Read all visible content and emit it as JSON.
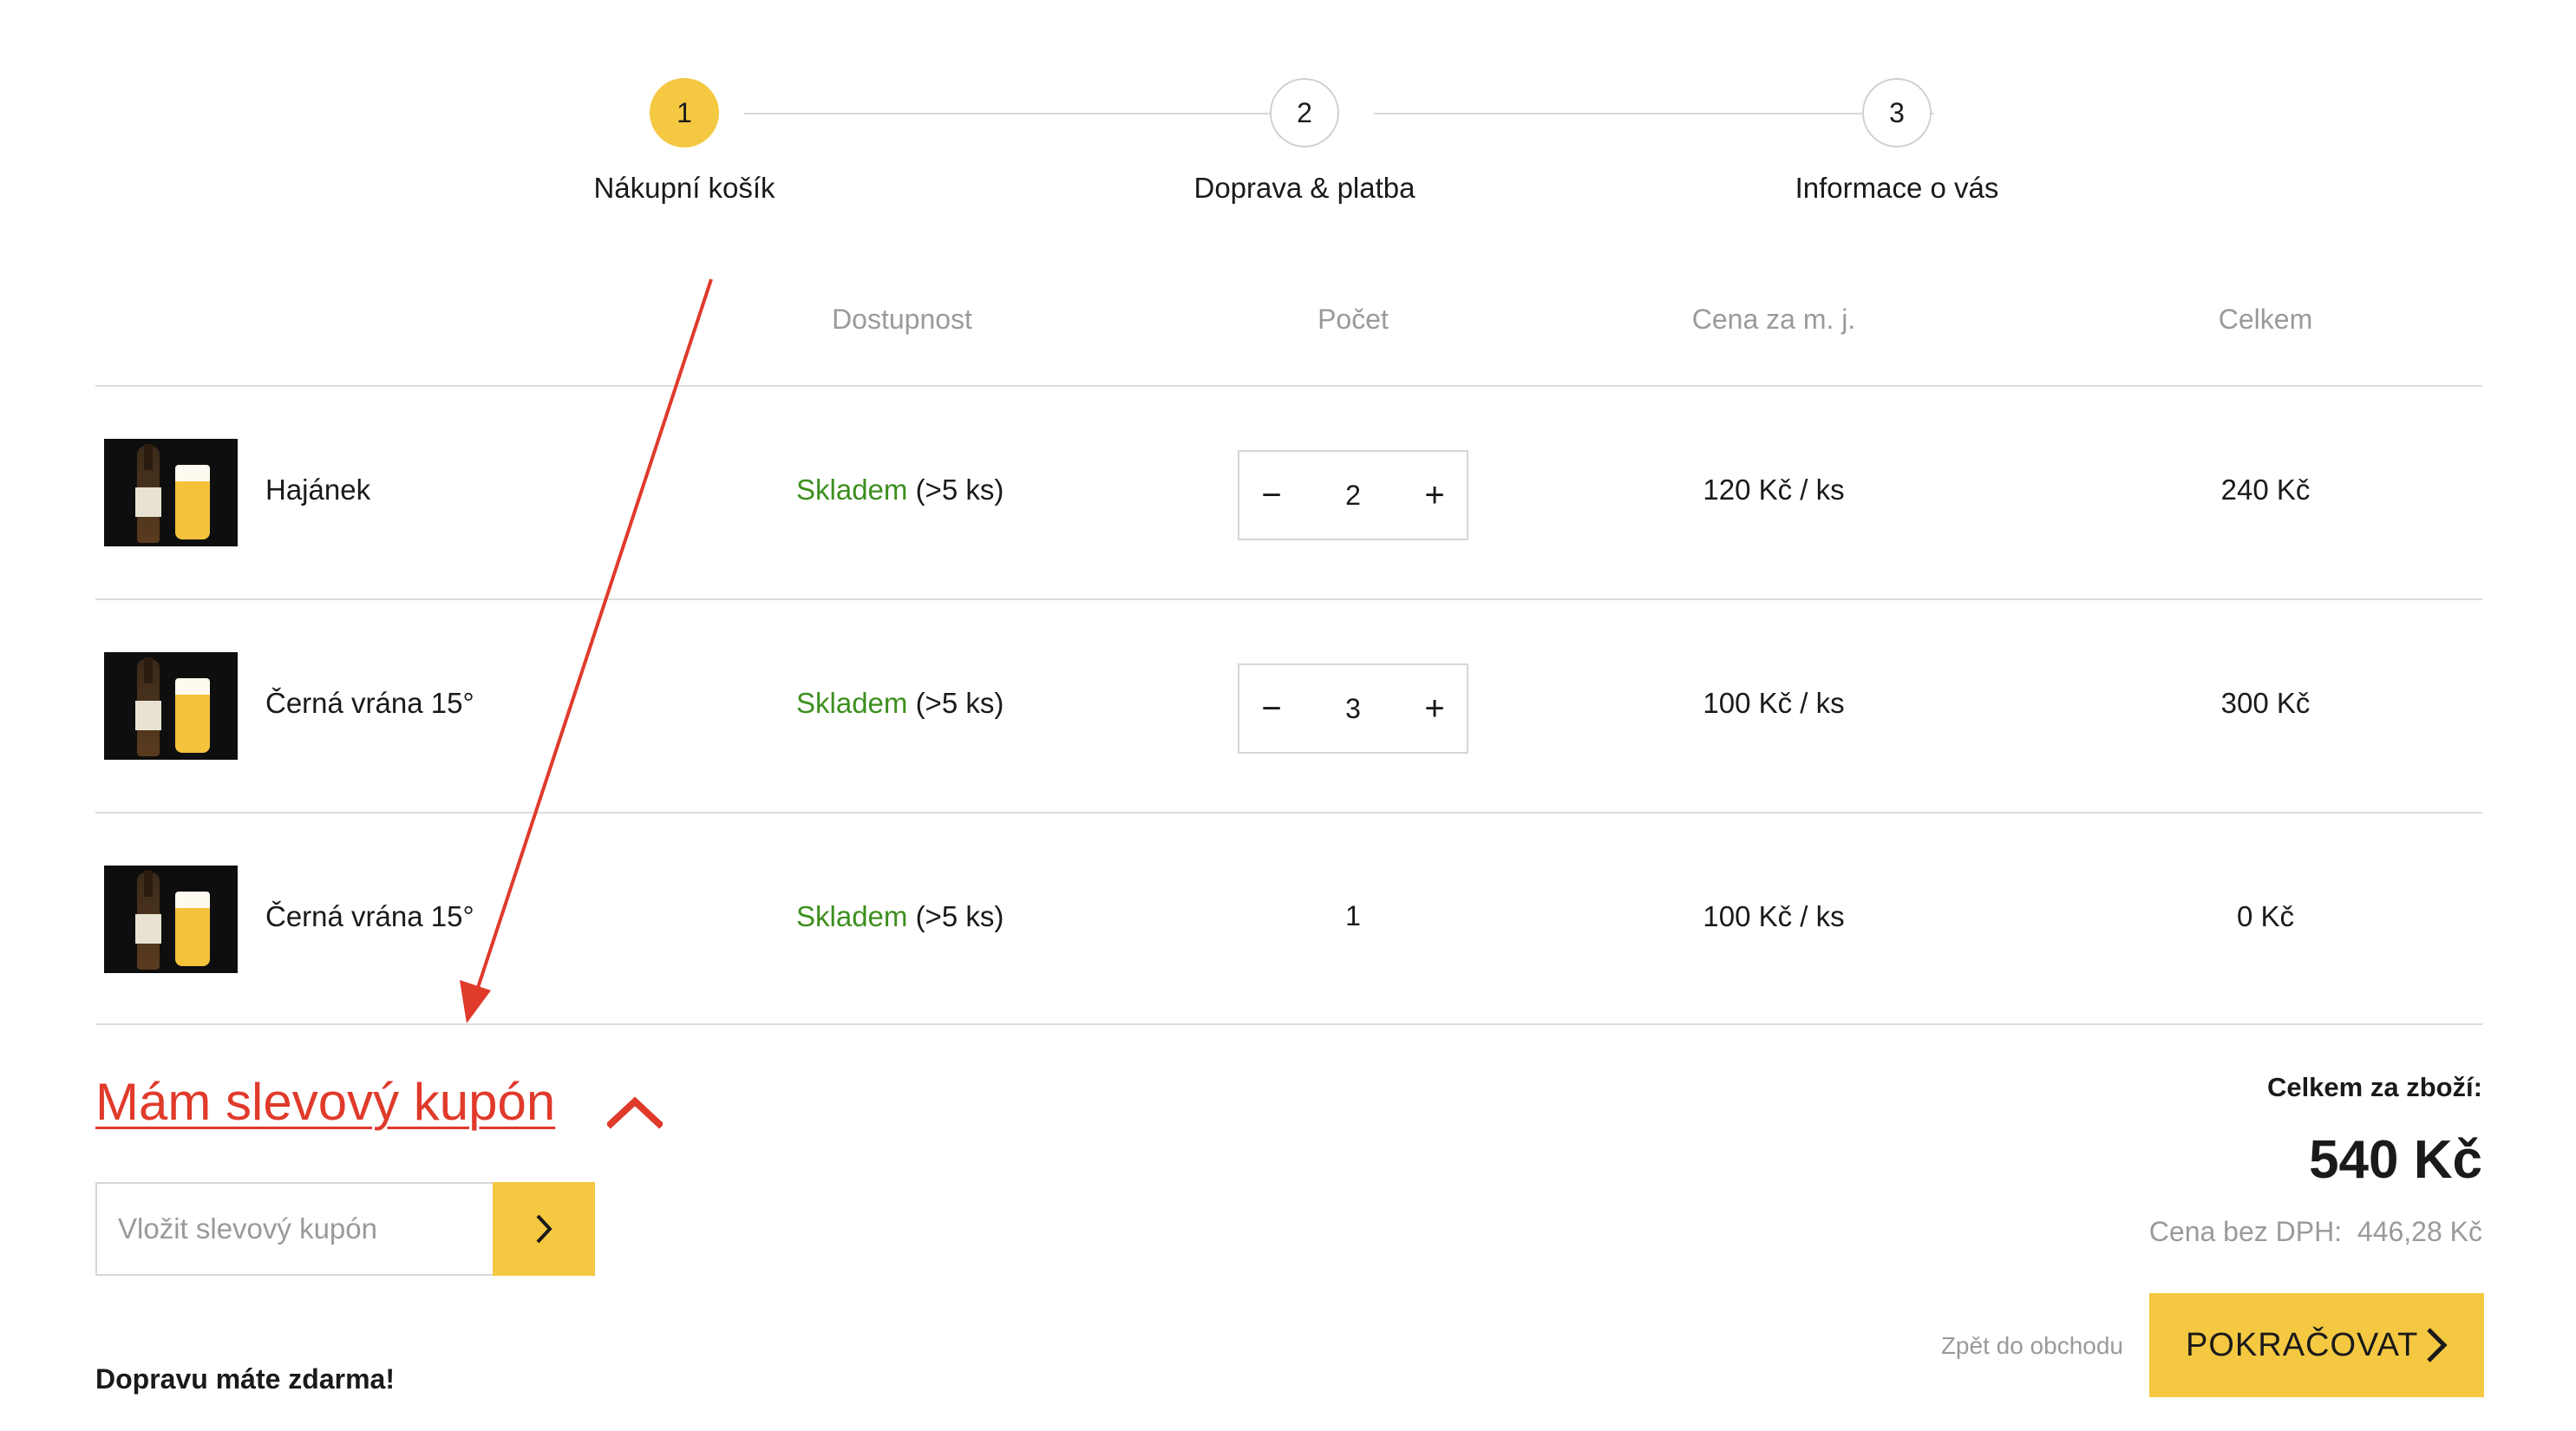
{
  "colors": {
    "accent": "#f5c842",
    "stock_green": "#3d8f1e",
    "coupon_red": "#e03a2b",
    "annotation_arrow": "#e03a2b"
  },
  "stepper": {
    "steps": [
      {
        "number": "1",
        "label": "Nákupní košík",
        "active": true
      },
      {
        "number": "2",
        "label": "Doprava & platba",
        "active": false
      },
      {
        "number": "3",
        "label": "Informace o vás",
        "active": false
      }
    ]
  },
  "table": {
    "headers": {
      "availability": "Dostupnost",
      "quantity": "Počet",
      "unit_price": "Cena za m. j.",
      "total": "Celkem"
    },
    "rows": [
      {
        "name": "Hajánek",
        "availability_status": "Skladem",
        "availability_detail": "(>5 ks)",
        "quantity": "2",
        "unit_price": "120 Kč / ks",
        "total": "240 Kč",
        "editable": true,
        "image_icon": "beer-bottle-and-glass"
      },
      {
        "name": "Černá vrána 15°",
        "availability_status": "Skladem",
        "availability_detail": "(>5 ks)",
        "quantity": "3",
        "unit_price": "100 Kč / ks",
        "total": "300 Kč",
        "editable": true,
        "image_icon": "beer-bottle-and-glass"
      },
      {
        "name": "Černá vrána 15°",
        "availability_status": "Skladem",
        "availability_detail": "(>5 ks)",
        "quantity": "1",
        "unit_price": "100 Kč / ks",
        "total": "0 Kč",
        "editable": false,
        "image_icon": "beer-bottle-and-glass"
      }
    ],
    "minus_icon": "−",
    "plus_icon": "+"
  },
  "coupon": {
    "toggle_label": "Mám slevový kupón",
    "toggle_icon": "chevron-up-icon",
    "input_placeholder": "Vložit slevový kupón",
    "submit_icon": "chevron-right-icon"
  },
  "shipping_note": "Dopravu máte zdarma!",
  "summary": {
    "label": "Celkem za zboží:",
    "value": "540 Kč",
    "without_vat_label": "Cena bez DPH:",
    "without_vat_value": "446,28 Kč"
  },
  "actions": {
    "back_label": "Zpět do obchodu",
    "continue_label": "POKRAČOVAT",
    "continue_icon": "chevron-right-icon"
  }
}
